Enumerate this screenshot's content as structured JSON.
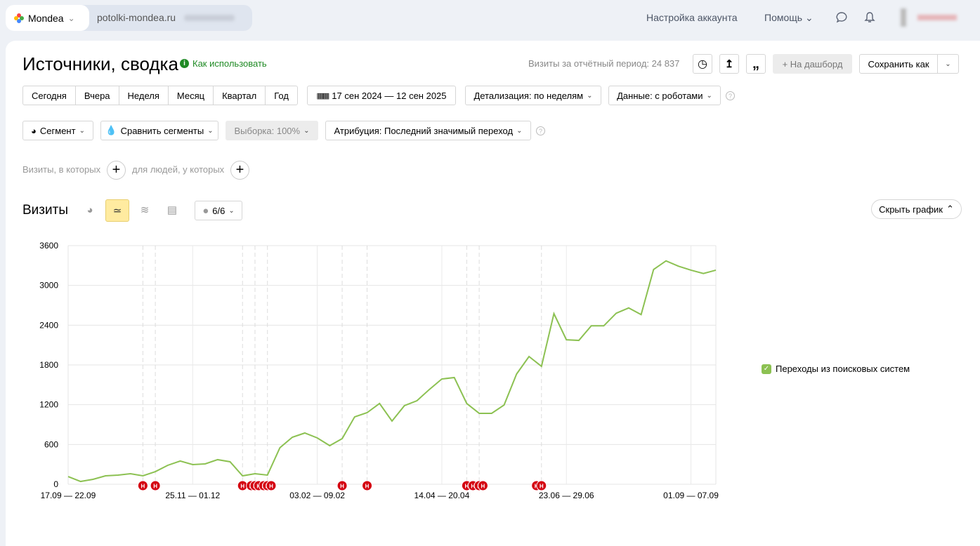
{
  "header": {
    "counter_name": "Mondea",
    "site": "potolki-mondea.ru",
    "account_settings": "Настройка аккаунта",
    "help": "Помощь"
  },
  "page": {
    "title": "Источники, сводка",
    "how_to": "Как использовать",
    "visits_total": "Визиты за отчётный период: 24 837",
    "to_dashboard": "+ На дашборд",
    "save_as": "Сохранить как"
  },
  "periods": [
    "Сегодня",
    "Вчера",
    "Неделя",
    "Месяц",
    "Квартал",
    "Год"
  ],
  "filters": {
    "date_range": "17 сен 2024 — 12 сен 2025",
    "detail": "Детализация: по неделям",
    "data": "Данные: с роботами",
    "segment": "Сегмент",
    "compare": "Сравнить сегменты",
    "sample": "Выборка: 100%",
    "attribution": "Атрибуция: Последний значимый переход"
  },
  "conditions": {
    "visits_where": "Визиты, в которых",
    "people_where": "для людей, у которых"
  },
  "chart_panel": {
    "title": "Визиты",
    "annotations_count": "6/6",
    "hide_chart": "Скрыть график"
  },
  "chart_data": {
    "type": "line",
    "ylim": [
      0,
      3600
    ],
    "yticks": [
      0,
      600,
      1200,
      1800,
      2400,
      3000,
      3600
    ],
    "xtick_labels": [
      {
        "week": 0,
        "label": "17.09 — 22.09"
      },
      {
        "week": 10,
        "label": "25.11 — 01.12"
      },
      {
        "week": 20,
        "label": "03.02 — 09.02"
      },
      {
        "week": 30,
        "label": "14.04 — 20.04"
      },
      {
        "week": 40,
        "label": "23.06 — 29.06"
      },
      {
        "week": 50,
        "label": "01.09 — 07.09"
      }
    ],
    "series": [
      {
        "name": "Переходы из поисковых систем",
        "color": "#8cc152",
        "values": [
          116,
          42,
          74,
          127,
          138,
          159,
          127,
          190,
          286,
          350,
          297,
          307,
          371,
          339,
          127,
          159,
          138,
          551,
          709,
          773,
          699,
          582,
          688,
          1016,
          1080,
          1218,
          953,
          1186,
          1260,
          1430,
          1588,
          1610,
          1218,
          1070,
          1070,
          1196,
          1662,
          1927,
          1779,
          2574,
          2180,
          2170,
          2390,
          2390,
          2580,
          2660,
          2560,
          3240,
          3370,
          3290,
          3230,
          3180,
          3230
        ]
      }
    ],
    "annotation_label": "Н",
    "annotations": [
      6,
      7,
      14,
      14.7,
      15,
      15.3,
      15.7,
      16,
      16.3,
      22,
      24,
      32,
      32.5,
      33,
      33.3,
      37.6,
      38
    ],
    "annotation_lines": [
      6,
      7,
      14,
      15,
      16,
      22,
      24,
      32,
      33,
      38
    ],
    "legend": "right"
  }
}
